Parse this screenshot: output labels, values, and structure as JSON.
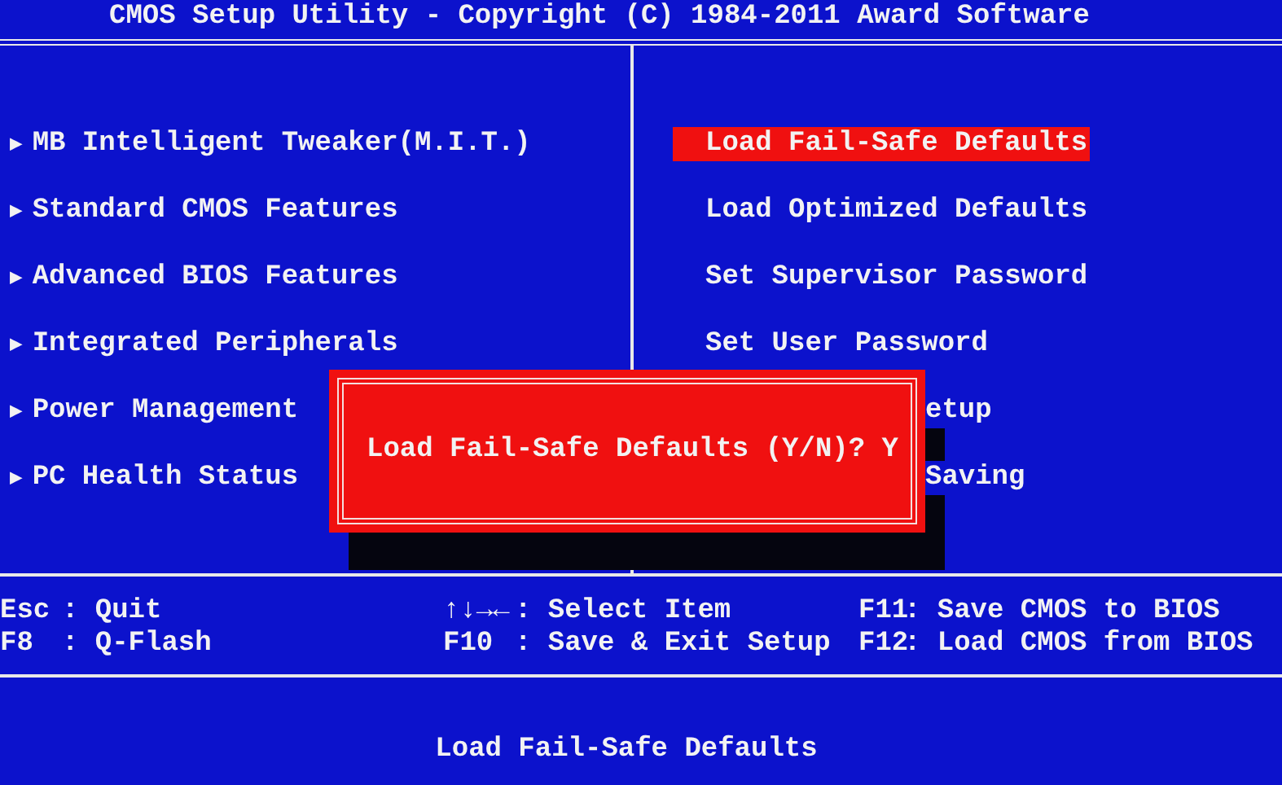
{
  "header": {
    "title": "CMOS Setup Utility - Copyright (C) 1984-2011 Award Software"
  },
  "left_menu": [
    {
      "arrow": "▶",
      "label": "MB Intelligent Tweaker(M.I.T.)"
    },
    {
      "arrow": "▶",
      "label": "Standard CMOS Features"
    },
    {
      "arrow": "▶",
      "label": "Advanced BIOS Features"
    },
    {
      "arrow": "▶",
      "label": "Integrated Peripherals"
    },
    {
      "arrow": "▶",
      "label": "Power Management"
    },
    {
      "arrow": "▶",
      "label": "PC Health Status"
    }
  ],
  "right_menu": [
    {
      "label": "Load Fail-Safe Defaults",
      "selected": true,
      "kind": "full"
    },
    {
      "label": "Load Optimized Defaults",
      "selected": false,
      "kind": "full"
    },
    {
      "label": "Set Supervisor Password",
      "selected": false,
      "kind": "full"
    },
    {
      "label": "Set User Password",
      "selected": false,
      "kind": "full"
    },
    {
      "label": "etup",
      "selected": false,
      "kind": "clipped"
    },
    {
      "label": "Saving",
      "selected": false,
      "kind": "clipped"
    }
  ],
  "dialog": {
    "prompt": "Load Fail-Safe Defaults (Y/N)? Y"
  },
  "key_help": [
    [
      {
        "key": "Esc",
        "separator": ":",
        "action": "Quit"
      },
      {
        "key": "F8",
        "separator": ":",
        "action": "Q-Flash"
      }
    ],
    [
      {
        "key": "↑↓→←",
        "separator": ":",
        "action": "Select Item"
      },
      {
        "key": "F10",
        "separator": ":",
        "action": "Save & Exit Setup"
      }
    ],
    [
      {
        "key": "F11",
        "separator": ":",
        "action": "Save CMOS to BIOS"
      },
      {
        "key": "F12",
        "separator": ":",
        "action": "Load CMOS from BIOS"
      }
    ]
  ],
  "status_line": "Load Fail-Safe Defaults"
}
